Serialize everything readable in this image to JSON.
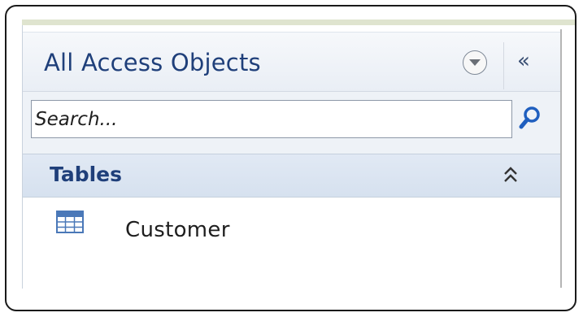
{
  "navpane": {
    "title": "All Access Objects",
    "menu_icon": "chevron-down-circle-icon",
    "collapse_label": "«",
    "search": {
      "placeholder": "Search...",
      "value": "",
      "icon": "magnifier-icon"
    },
    "groups": [
      {
        "label": "Tables",
        "toggle_icon": "double-chevron-up-icon",
        "items": [
          {
            "label": "Customer",
            "icon": "table-icon"
          }
        ]
      }
    ]
  },
  "colors": {
    "title_text": "#1f3f7a",
    "group_bar": "#d6e1ef",
    "top_band": "#dfe4cf"
  }
}
